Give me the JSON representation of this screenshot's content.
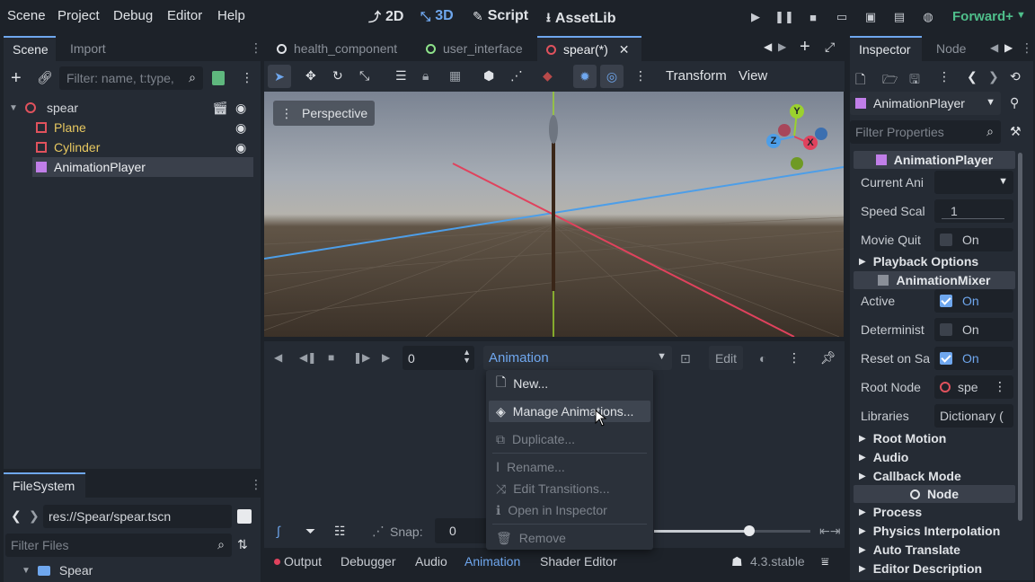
{
  "menubar": {
    "items": [
      "Scene",
      "Project",
      "Debug",
      "Editor",
      "Help"
    ],
    "modes": {
      "two_d": "2D",
      "three_d": "3D",
      "script": "Script",
      "assetlib": "AssetLib"
    },
    "renderer": "Forward+"
  },
  "scene_dock": {
    "tabs": [
      "Scene",
      "Import"
    ],
    "filter_placeholder": "Filter: name, t:type,",
    "tree": [
      {
        "label": "spear",
        "type": "root"
      },
      {
        "label": "Plane",
        "type": "mesh"
      },
      {
        "label": "Cylinder",
        "type": "mesh"
      },
      {
        "label": "AnimationPlayer",
        "type": "anim",
        "selected": true
      }
    ]
  },
  "filesystem_dock": {
    "tab": "FileSystem",
    "path": "res://Spear/spear.tscn",
    "filter_placeholder": "Filter Files",
    "folder": "Spear"
  },
  "editor_tabs": [
    {
      "label": "health_component",
      "icon": "node-icon"
    },
    {
      "label": "user_interface",
      "icon": "control-icon"
    },
    {
      "label": "spear(*)",
      "icon": "node3d-icon",
      "active": true
    }
  ],
  "viewport_toolbar": {
    "transform": "Transform",
    "view": "View"
  },
  "viewport": {
    "perspective": "Perspective",
    "gizmo": {
      "y": "Y",
      "x": "X",
      "z": "Z"
    }
  },
  "animation_panel": {
    "time_value": "0",
    "anim_button": "Animation",
    "edit_button": "Edit",
    "snap_label": "Snap:",
    "snap_value": "0"
  },
  "anim_menu": {
    "items": [
      {
        "label": "New...",
        "disabled": false
      },
      {
        "label": "Manage Animations...",
        "disabled": false,
        "hovered": true
      },
      {
        "label": "Duplicate...",
        "disabled": true
      },
      {
        "label": "Rename...",
        "disabled": true
      },
      {
        "label": "Edit Transitions...",
        "disabled": true
      },
      {
        "label": "Open in Inspector",
        "disabled": true
      },
      {
        "label": "Remove",
        "disabled": true
      }
    ]
  },
  "bottom_tabs": [
    "Output",
    "Debugger",
    "Audio",
    "Animation",
    "Shader Editor"
  ],
  "version": "4.3.stable",
  "inspector": {
    "tabs": [
      "Inspector",
      "Node"
    ],
    "node_type": "AnimationPlayer",
    "filter_placeholder": "Filter Properties",
    "group1": "AnimationPlayer",
    "current_anim_label": "Current Ani",
    "speed_label": "Speed Scal",
    "speed_value": "1",
    "movie_label": "Movie Quit",
    "movie_value": "On",
    "playback_section": "Playback Options",
    "group2": "AnimationMixer",
    "active_label": "Active",
    "active_value": "On",
    "determ_label": "Determinist",
    "determ_value": "On",
    "reset_label": "Reset on Sa",
    "reset_value": "On",
    "root_node_label": "Root Node",
    "root_node_value": "spe",
    "libraries_label": "Libraries",
    "libraries_value": "Dictionary (",
    "sections1": [
      "Root Motion",
      "Audio",
      "Callback Mode"
    ],
    "group3": "Node",
    "sections2": [
      "Process",
      "Physics Interpolation",
      "Auto Translate",
      "Editor Description"
    ]
  },
  "colors": {
    "accent": "#6fa7ee",
    "x_axis": "#e0425d",
    "z_axis": "#4d9ee8",
    "y_axis": "#9bd12e"
  }
}
